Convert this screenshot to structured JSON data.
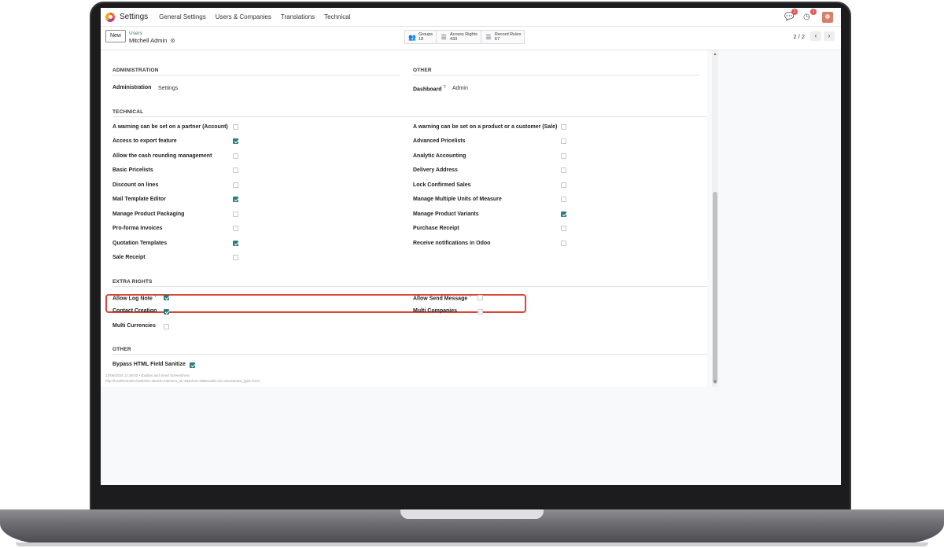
{
  "app": {
    "name": "Settings",
    "menu": [
      "General Settings",
      "Users & Companies",
      "Translations",
      "Technical"
    ],
    "chat_badge": "1",
    "activity_badge": "1"
  },
  "control_panel": {
    "new_label": "New",
    "breadcrumb_parent": "Users",
    "breadcrumb_current": "Mitchell Admin",
    "smart_buttons": [
      {
        "label": "Groups",
        "count": "18",
        "icon": "users-icon"
      },
      {
        "label": "Access Rights",
        "count": "433",
        "icon": "list-icon"
      },
      {
        "label": "Record Rules",
        "count": "67",
        "icon": "list-icon"
      }
    ],
    "pager": "2 / 2"
  },
  "sections": {
    "administration": {
      "title": "ADMINISTRATION",
      "label": "Administration",
      "value": "Settings"
    },
    "other_top": {
      "title": "OTHER",
      "label": "Dashboard",
      "value": "Admin"
    },
    "technical": {
      "title": "TECHNICAL",
      "left": [
        {
          "label": "A warning can be set on a partner (Account)",
          "checked": false
        },
        {
          "label": "Access to export feature",
          "checked": true
        },
        {
          "label": "Allow the cash rounding management",
          "checked": false
        },
        {
          "label": "Basic Pricelists",
          "checked": false
        },
        {
          "label": "Discount on lines",
          "checked": false
        },
        {
          "label": "Mail Template Editor",
          "checked": true
        },
        {
          "label": "Manage Product Packaging",
          "checked": false
        },
        {
          "label": "Pro-forma Invoices",
          "checked": false
        },
        {
          "label": "Quotation Templates",
          "checked": true
        },
        {
          "label": "Sale Receipt",
          "checked": false
        }
      ],
      "right": [
        {
          "label": "A warning can be set on a product or a customer (Sale)",
          "checked": false
        },
        {
          "label": "Advanced Pricelists",
          "checked": false
        },
        {
          "label": "Analytic Accounting",
          "checked": false
        },
        {
          "label": "Delivery Address",
          "checked": false
        },
        {
          "label": "Lock Confirmed Sales",
          "checked": false
        },
        {
          "label": "Manage Multiple Units of Measure",
          "checked": false
        },
        {
          "label": "Manage Product Variants",
          "checked": true
        },
        {
          "label": "Purchase Receipt",
          "checked": false
        },
        {
          "label": "Receive notifications in Odoo",
          "checked": false
        }
      ]
    },
    "extra_rights": {
      "title": "EXTRA RIGHTS",
      "left": [
        {
          "label": "Allow Log Note",
          "checked": true,
          "help": "?"
        },
        {
          "label": "Contact Creation",
          "checked": true
        },
        {
          "label": "Multi Currencies",
          "checked": false
        }
      ],
      "right": [
        {
          "label": "Allow Send Message",
          "checked": false,
          "help": "?"
        },
        {
          "label": "Multi Companies",
          "checked": false
        }
      ]
    },
    "other_bottom": {
      "title": "OTHER",
      "label": "Bypass HTML Field Sanitize",
      "checked": true
    }
  },
  "footer": {
    "line1": "12/06/2024 12:48:03 • Explain and Send Screenshots",
    "line2": "http://localhost:8017/web#id=2&cids=1&menu_id=4&action=65&model=res.users&view_type=form"
  },
  "colors": {
    "accent": "#2e7d7a",
    "highlight": "#d9453b",
    "badge": "#e25555"
  }
}
